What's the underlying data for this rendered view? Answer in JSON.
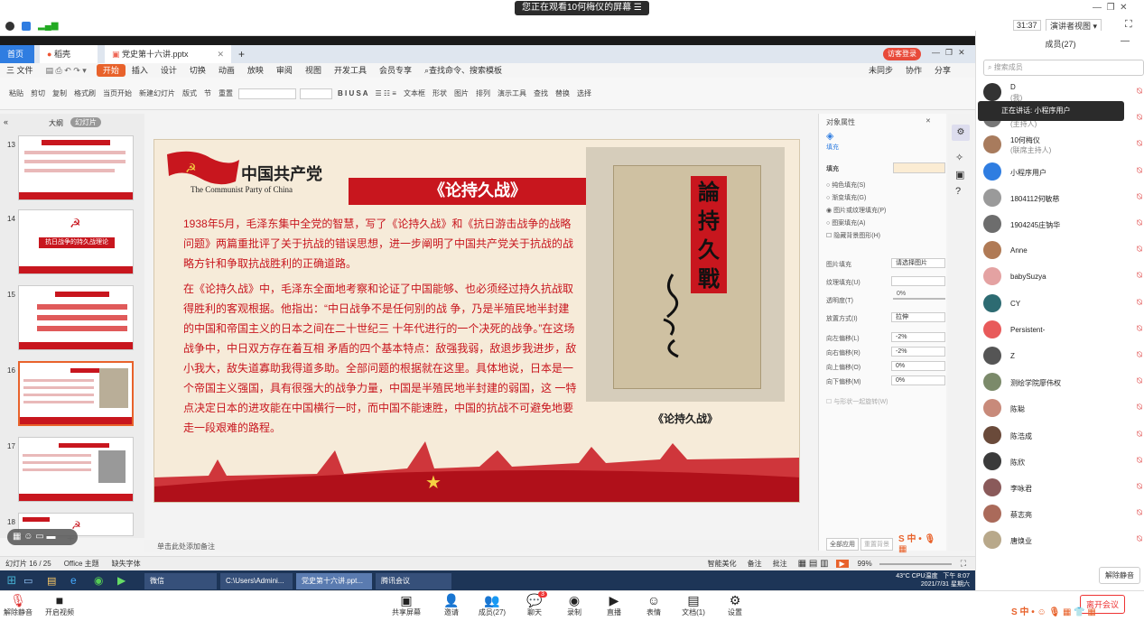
{
  "meeting": {
    "share_notice": "您正在观看10何梅仪的屏幕",
    "time": "31:37",
    "presenter_view": "演讲者视图",
    "members_title": "成员(27)",
    "search_placeholder": "搜索成员",
    "speaking_tip": "正在讲话: 小程序用户",
    "mute_all": "解除静音",
    "end_meeting": "离开会议",
    "members": [
      {
        "name": "D",
        "sub": "(我)",
        "color": "#333"
      },
      {
        "name": "",
        "sub": "(主持人)",
        "color": "#777"
      },
      {
        "name": "10何梅仪",
        "sub": "(联席主持人)",
        "color": "#a87b5d"
      },
      {
        "name": "小程序用户",
        "sub": "",
        "color": "#2f7de1"
      },
      {
        "name": "1804112何敏慈",
        "sub": "",
        "color": "#9a9a9a"
      },
      {
        "name": "1904245庄钠华",
        "sub": "",
        "color": "#6d6d6d"
      },
      {
        "name": "Anne",
        "sub": "",
        "color": "#b07a55"
      },
      {
        "name": "babySuzya",
        "sub": "",
        "color": "#e4a2a2"
      },
      {
        "name": "CY",
        "sub": "",
        "color": "#2d6b72"
      },
      {
        "name": "Persistent-",
        "sub": "",
        "color": "#e85a5a"
      },
      {
        "name": "Z",
        "sub": "",
        "color": "#555"
      },
      {
        "name": "测绘学院廖伟权",
        "sub": "",
        "color": "#7b8a6a"
      },
      {
        "name": "陈聪",
        "sub": "",
        "color": "#c88a7a"
      },
      {
        "name": "陈浩成",
        "sub": "",
        "color": "#6a4a3a"
      },
      {
        "name": "陈欣",
        "sub": "",
        "color": "#3a3a3a"
      },
      {
        "name": "李咏君",
        "sub": "",
        "color": "#8a5a5a"
      },
      {
        "name": "蔡志亮",
        "sub": "",
        "color": "#aa6a5a"
      },
      {
        "name": "唐焕业",
        "sub": "",
        "color": "#b8a88a"
      }
    ],
    "bottom": {
      "unmute": "解除静音",
      "video": "开启视频",
      "share": "共享屏幕",
      "invite": "邀请",
      "members": "成员(27)",
      "chat": "聊天",
      "chat_badge": "3",
      "record": "录制",
      "live": "直播",
      "reaction": "表情",
      "docs": "文档(1)",
      "settings": "设置"
    }
  },
  "wps": {
    "tabs": [
      "首页",
      "稻壳",
      "党史第十六讲.pptx"
    ],
    "user_btn": "访客登录",
    "menus": [
      "三 文件",
      "开始",
      "插入",
      "设计",
      "切换",
      "动画",
      "放映",
      "审阅",
      "视图",
      "开发工具",
      "会员专享"
    ],
    "search": "查找命令、搜索模板",
    "right_actions": [
      "未同步",
      "协作",
      "分享"
    ],
    "ribbon": [
      "粘贴",
      "剪切",
      "复制",
      "格式刷",
      "当页开始",
      "新建幻灯片",
      "版式",
      "节",
      "重置",
      "文本框",
      "形状",
      "图片",
      "排列",
      "演示工具",
      "查找",
      "替换",
      "选择"
    ],
    "panel_tabs": [
      "大纲",
      "幻灯片"
    ],
    "thumb_numbers": [
      "13",
      "14",
      "15",
      "16",
      "17",
      "18"
    ],
    "thumb14_title": "抗日战争的持久战理论",
    "note_hint": "单击此处添加备注",
    "status": [
      "幻灯片 16 / 25",
      "Office 主题",
      "缺失字体"
    ],
    "status_right": [
      "智能美化",
      "备注",
      "批注",
      "99%"
    ]
  },
  "slide": {
    "cpc_cn": "中国共产党",
    "cpc_en": "The Communist Party of China",
    "title": "《论持久战》",
    "p1": "1938年5月，毛泽东集中全党的智慧，写了《论持久战》和《抗日游击战争的战略问题》两篇重批评了关于抗战的错误思想，进一步阐明了中国共产党关于抗战的战略方针和争取抗战胜利的正确道路。",
    "p2": "在《论持久战》中，毛泽东全面地考察和论证了中国能够、也必须经过持久抗战取得胜利的客观根据。他指出：“中日战争不是任何别的战 争，乃是半殖民地半封建的中国和帝国主义的日本之间在二十世纪三 十年代进行的一个决死的战争。”在这场战争中，中日双方存在着互相 矛盾的四个基本特点：敌强我弱，敌退步我进步，敌小我大，敌失道寡助我得道多助。全部问题的根据就在这里。具体地说，日本是一个帝国主义强国，具有很强大的战争力量，中国是半殖民地半封建的弱国，这 一特点决定日本的进攻能在中国横行一时，而中国不能速胜，中国的抗战不可避免地要走一段艰难的路程。",
    "book_title": "論持久戰",
    "caption": "《论持久战》"
  },
  "props": {
    "title": "对象属性",
    "tab": "填充",
    "section": "填充",
    "options": [
      "纯色填充(S)",
      "渐变填充(G)",
      "图片或纹理填充(P)",
      "图案填充(A)",
      "隐藏背景图形(H)"
    ],
    "image_fill": "图片填充",
    "image_fill_val": "请选择图片",
    "texture_fill": "纹理填充(U)",
    "transparency": "透明度(T)",
    "transparency_val": "0%",
    "placement": "放置方式(I)",
    "placement_val": "拉伸",
    "offsets": [
      {
        "label": "向左偏移(L)",
        "val": "-2%"
      },
      {
        "label": "向右偏移(R)",
        "val": "-2%"
      },
      {
        "label": "向上偏移(O)",
        "val": "0%"
      },
      {
        "label": "向下偏移(M)",
        "val": "0%"
      }
    ],
    "rotate": "与形状一起旋转(W)",
    "apply_all": "全部应用",
    "reset_bg": "重置背景"
  },
  "taskbar": [
    "微信",
    "C:\\Users\\Admini...",
    "党史第十六讲.ppt...",
    "腾讯会议"
  ],
  "clock": {
    "temp": "43°C",
    "cpu": "CPU温度",
    "time": "下午 8:07",
    "date": "2021/7/31 星期六"
  },
  "colors": {
    "red": "#c8161e",
    "cream": "#f6ebd9",
    "blue": "#2f7de1"
  }
}
